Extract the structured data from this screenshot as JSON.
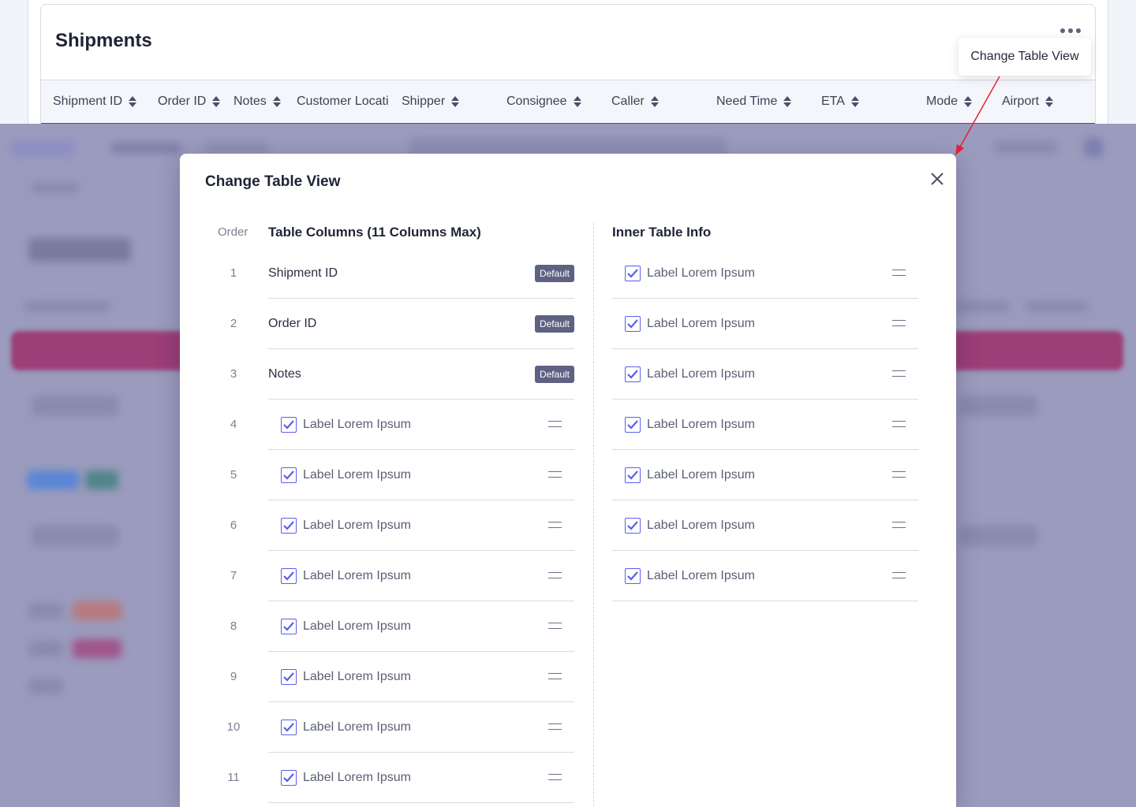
{
  "page_header": {
    "title": "Shipments",
    "columns": [
      "Shipment ID",
      "Order ID",
      "Notes",
      "Customer Locati",
      "Shipper",
      "Consignee",
      "Caller",
      "Need Time",
      "ETA",
      "Mode",
      "Airport"
    ],
    "tooltip": "Change Table View"
  },
  "modal": {
    "title": "Change Table View",
    "order_label": "Order",
    "columns_heading": "Table Columns (11 Columns Max)",
    "inner_heading": "Inner Table Info",
    "default_badge": "Default",
    "table_columns": [
      {
        "order": "1",
        "label": "Shipment ID",
        "default": true
      },
      {
        "order": "2",
        "label": "Order ID",
        "default": true
      },
      {
        "order": "3",
        "label": "Notes",
        "default": true
      },
      {
        "order": "4",
        "label": "Label Lorem Ipsum",
        "checked": true
      },
      {
        "order": "5",
        "label": "Label Lorem Ipsum",
        "checked": true
      },
      {
        "order": "6",
        "label": "Label Lorem Ipsum",
        "checked": true
      },
      {
        "order": "7",
        "label": "Label Lorem Ipsum",
        "checked": true
      },
      {
        "order": "8",
        "label": "Label Lorem Ipsum",
        "checked": true
      },
      {
        "order": "9",
        "label": "Label Lorem Ipsum",
        "checked": true
      },
      {
        "order": "10",
        "label": "Label Lorem Ipsum",
        "checked": true
      },
      {
        "order": "11",
        "label": "Label Lorem Ipsum",
        "checked": true
      }
    ],
    "inner_table_info": [
      {
        "label": "Label Lorem Ipsum",
        "checked": true
      },
      {
        "label": "Label Lorem Ipsum",
        "checked": true
      },
      {
        "label": "Label Lorem Ipsum",
        "checked": true
      },
      {
        "label": "Label Lorem Ipsum",
        "checked": true
      },
      {
        "label": "Label Lorem Ipsum",
        "checked": true
      },
      {
        "label": "Label Lorem Ipsum",
        "checked": true
      },
      {
        "label": "Label Lorem Ipsum",
        "checked": true
      }
    ]
  },
  "icons": {
    "sort": "sort-icon",
    "close": "close-icon",
    "drag": "drag-handle-icon",
    "check": "checkbox-checked-icon",
    "more": "more-horizontal-icon"
  },
  "colors": {
    "accent": "#5b5ef0",
    "badge": "#5d6282",
    "header_rule": "#b0283c",
    "annotation_arrow": "#e8222f",
    "overlay": "#9b9bbd"
  }
}
